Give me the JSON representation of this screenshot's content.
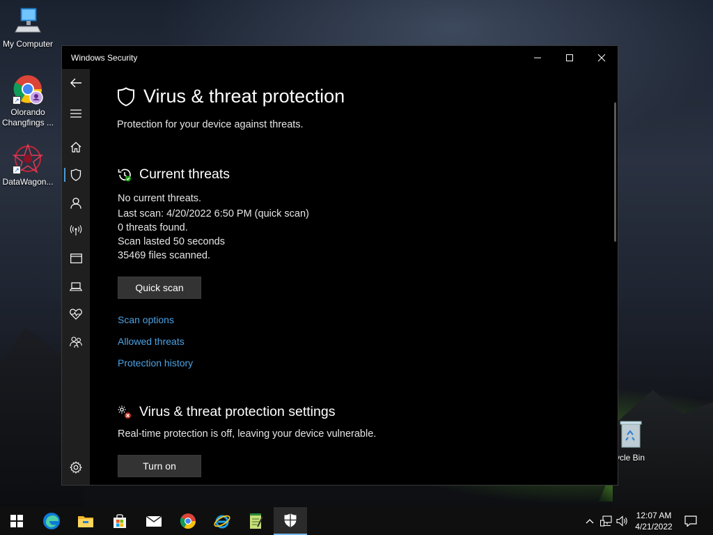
{
  "desktop": {
    "icons": [
      {
        "label": "My Computer"
      },
      {
        "label": "Olorando Changfings ..."
      },
      {
        "label": "DataWagon..."
      },
      {
        "label": "ycle Bin"
      }
    ]
  },
  "window": {
    "title": "Windows Security",
    "controls": {
      "minimize": "–",
      "maximize": "☐",
      "close": "✕"
    }
  },
  "sidebar": {
    "items": [
      {
        "name": "back",
        "icon": "back-arrow-icon"
      },
      {
        "name": "menu",
        "icon": "hamburger-icon"
      },
      {
        "name": "home",
        "icon": "home-icon"
      },
      {
        "name": "virus-protection",
        "icon": "shield-icon",
        "active": true
      },
      {
        "name": "account",
        "icon": "person-icon"
      },
      {
        "name": "firewall",
        "icon": "antenna-icon"
      },
      {
        "name": "app-browser",
        "icon": "browser-window-icon"
      },
      {
        "name": "device-security",
        "icon": "laptop-icon"
      },
      {
        "name": "device-performance",
        "icon": "heart-pulse-icon"
      },
      {
        "name": "family",
        "icon": "family-icon"
      },
      {
        "name": "settings",
        "icon": "gear-icon"
      }
    ],
    "accent": "#4c9bd9"
  },
  "page": {
    "title": "Virus & threat protection",
    "subtitle": "Protection for your device against threats.",
    "current_threats": {
      "heading": "Current threats",
      "lines": [
        "No current threats.",
        "Last scan: 4/20/2022 6:50 PM (quick scan)",
        "0 threats found.",
        "Scan lasted 50 seconds",
        "35469 files scanned."
      ],
      "button": "Quick scan",
      "links": [
        "Scan options",
        "Allowed threats",
        "Protection history"
      ]
    },
    "settings": {
      "heading": "Virus & threat protection settings",
      "message": "Real-time protection is off, leaving your device vulnerable.",
      "button": "Turn on"
    },
    "link_color": "#4ca3e6"
  },
  "taskbar": {
    "pinned": [
      "start-icon",
      "edge-icon",
      "file-explorer-icon",
      "store-icon",
      "mail-icon",
      "chrome-icon",
      "ie-icon",
      "notepad-icon",
      "windows-security-icon"
    ],
    "time": "12:07 AM",
    "date": "4/21/2022"
  }
}
